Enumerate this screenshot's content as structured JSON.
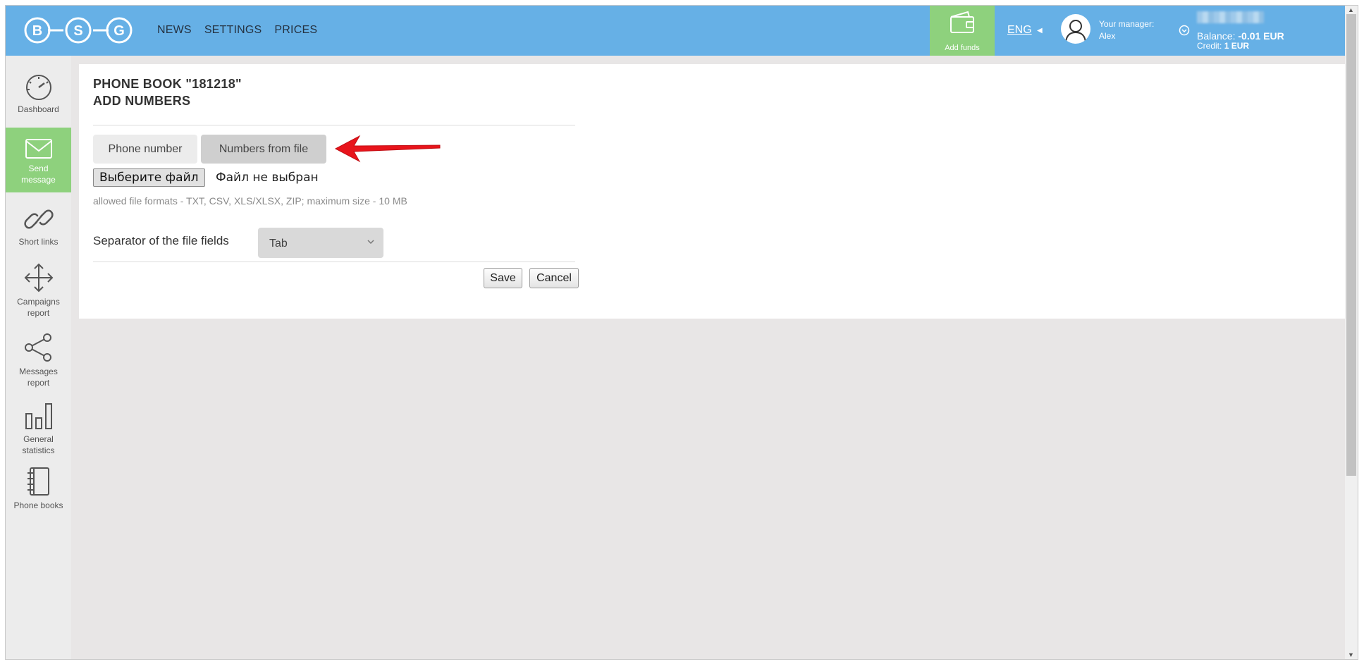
{
  "header": {
    "logo_letters": [
      "B",
      "S",
      "G"
    ],
    "nav": [
      "NEWS",
      "SETTINGS",
      "PRICES"
    ],
    "add_funds_label": "Add funds",
    "language": "ENG",
    "manager_label": "Your manager:",
    "manager_name": "Alex",
    "balance_label": "Balance:",
    "balance_value": "-0.01 EUR",
    "credit_label": "Credit:",
    "credit_value": "1 EUR"
  },
  "sidebar": {
    "items": [
      {
        "label": "Dashboard",
        "icon": "speedometer-icon"
      },
      {
        "label": "Send message",
        "icon": "envelope-icon"
      },
      {
        "label": "Short links",
        "icon": "link-icon"
      },
      {
        "label": "Campaigns report",
        "icon": "move-arrows-icon"
      },
      {
        "label": "Messages report",
        "icon": "share-icon"
      },
      {
        "label": "General statistics",
        "icon": "bar-chart-icon"
      },
      {
        "label": "Phone books",
        "icon": "notebook-icon"
      }
    ]
  },
  "main": {
    "title_line1": "PHONE BOOK \"181218\"",
    "title_line2": "ADD NUMBERS",
    "tabs": [
      "Phone number",
      "Numbers from file"
    ],
    "file_button": "Выберите файл",
    "file_status": "Файл не выбран",
    "hint": "allowed file formats - TXT, CSV, XLS/XLSX, ZIP; maximum size - 10 MB",
    "separator_label": "Separator of the file fields",
    "separator_value": "Tab",
    "save_label": "Save",
    "cancel_label": "Cancel"
  },
  "colors": {
    "header": "#66b0e6",
    "accent_green": "#8ed17d",
    "annotation_arrow": "#e8141b"
  }
}
